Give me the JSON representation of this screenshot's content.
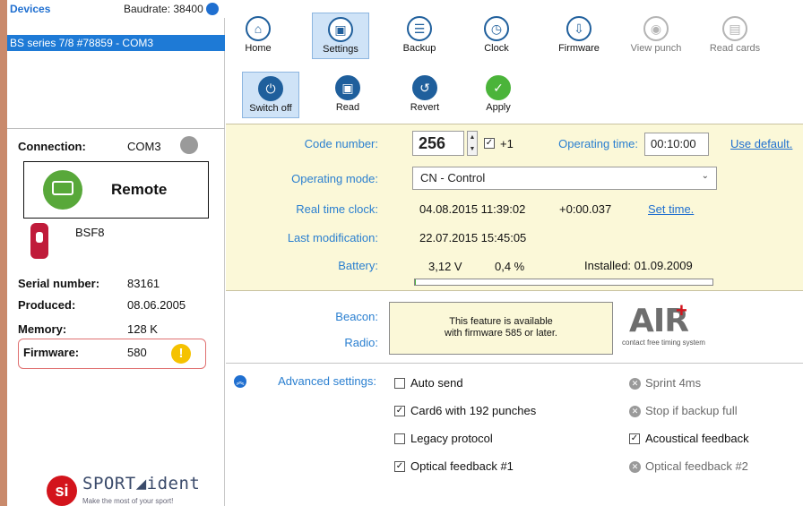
{
  "devices": {
    "header_label": "Devices",
    "baudrate": "Baudrate: 38400",
    "selected_device": "BS series 7/8 #78859 - COM3"
  },
  "connection": {
    "label": "Connection:",
    "value": "COM3",
    "mode": "Remote",
    "model": "BSF8"
  },
  "details": {
    "serial_label": "Serial number:",
    "serial_value": "83161",
    "produced_label": "Produced:",
    "produced_value": "08.06.2005",
    "memory_label": "Memory:",
    "memory_value": "128 K",
    "firmware_label": "Firmware:",
    "firmware_value": "580",
    "firmware_warning": "!"
  },
  "logo": {
    "mark": "si",
    "name": "SPORT◢ident",
    "tagline": "Make the most of your sport!"
  },
  "main_toolbar": [
    {
      "label": "Home",
      "icon": "home-icon"
    },
    {
      "label": "Settings",
      "icon": "settings-icon",
      "active": true
    },
    {
      "label": "Backup",
      "icon": "backup-icon"
    },
    {
      "label": "Clock",
      "icon": "clock-icon"
    },
    {
      "label": "Firmware",
      "icon": "firmware-icon"
    },
    {
      "label": "View punch",
      "icon": "view-punch-icon",
      "disabled": true
    },
    {
      "label": "Read cards",
      "icon": "read-cards-icon",
      "disabled": true
    }
  ],
  "action_toolbar": [
    {
      "label": "Switch off",
      "icon": "power-icon",
      "active": true
    },
    {
      "label": "Read",
      "icon": "read-icon"
    },
    {
      "label": "Revert",
      "icon": "revert-icon"
    },
    {
      "label": "Apply",
      "icon": "check-icon"
    }
  ],
  "settings": {
    "code_number_label": "Code number:",
    "code_number_value": "256",
    "increment_label": "+1",
    "operating_time_label": "Operating time:",
    "operating_time_value": "00:10:00",
    "use_default_link": "Use default.",
    "operating_mode_label": "Operating mode:",
    "operating_mode_value": "CN - Control",
    "rtc_label": "Real time clock:",
    "rtc_value": "04.08.2015 11:39:02",
    "rtc_offset": "+0:00.037",
    "set_time_link": "Set time.",
    "last_mod_label": "Last modification:",
    "last_mod_value": "22.07.2015 15:45:05",
    "battery_label": "Battery:",
    "battery_voltage": "3,12 V",
    "battery_percent": "0,4 %",
    "battery_level": 0.004,
    "battery_installed": "Installed: 01.09.2009"
  },
  "beacon": {
    "beacon_label": "Beacon:",
    "radio_label": "Radio:",
    "notice_line1": "This feature is available",
    "notice_line2": "with firmware 585 or later.",
    "air_logo_text": "AIR",
    "air_caption": "contact free timing system"
  },
  "advanced": {
    "label": "Advanced settings:",
    "options": [
      {
        "label": "Auto send",
        "checked": false
      },
      {
        "label": "Sprint 4ms",
        "disabled": true
      },
      {
        "label": "Card6 with 192 punches",
        "checked": true
      },
      {
        "label": "Stop if backup full",
        "disabled": true
      },
      {
        "label": "Legacy protocol",
        "checked": false
      },
      {
        "label": "Acoustical feedback",
        "checked": true
      },
      {
        "label": "Optical feedback #1",
        "checked": true
      },
      {
        "label": "Optical feedback #2",
        "disabled": true
      }
    ]
  },
  "colors": {
    "accent": "#1e7ad6",
    "panel_yellow": "#fbf8d8",
    "warning": "#f5c200",
    "success": "#4bb43a",
    "brand_red": "#d3141c"
  }
}
